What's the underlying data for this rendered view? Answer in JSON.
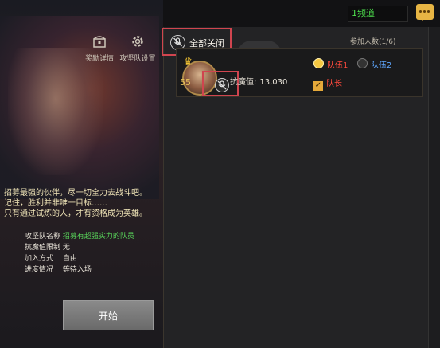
{
  "topbar": {
    "channel_label": "1频道",
    "chat_icon": "chat-bubble-icon"
  },
  "toolbar": {
    "reward_label": "奖励详情",
    "settings_label": "攻坚队设置",
    "reward_icon": "treasure-chest-icon",
    "settings_icon": "gear-icon"
  },
  "voice": {
    "mute_all_label": "全部关闭",
    "mute_icon": "microphone-muted-icon"
  },
  "team": {
    "member_count_label": "参加人数(1/6)",
    "member": {
      "level": "55",
      "power_label": "抗魔值:",
      "power_value": "13,030"
    },
    "squad1_label": "队伍1",
    "squad2_label": "队伍2",
    "leader_label": "队长",
    "leader_checked": true,
    "squad1_selected": true
  },
  "description": {
    "line1": "招募最强的伙伴，尽一切全力去战斗吧。",
    "line2": "记住，胜利并非唯一目标……",
    "line3": "只有通过试炼的人，才有资格成为英雄。"
  },
  "info": [
    {
      "key": "攻坚队名称",
      "value": "招募有超强实力的队员"
    },
    {
      "key": "抗魔值限制",
      "value": "无"
    },
    {
      "key": "加入方式",
      "value": "自由"
    },
    {
      "key": "进度情况",
      "value": "等待入场"
    }
  ],
  "actions": {
    "start_label": "开始"
  },
  "colors": {
    "highlight_red": "#d0454f",
    "green_text": "#58d45a",
    "squad1_red": "#ff4a3d",
    "squad2_blue": "#5fa7ff",
    "gold": "#e5a93a"
  }
}
